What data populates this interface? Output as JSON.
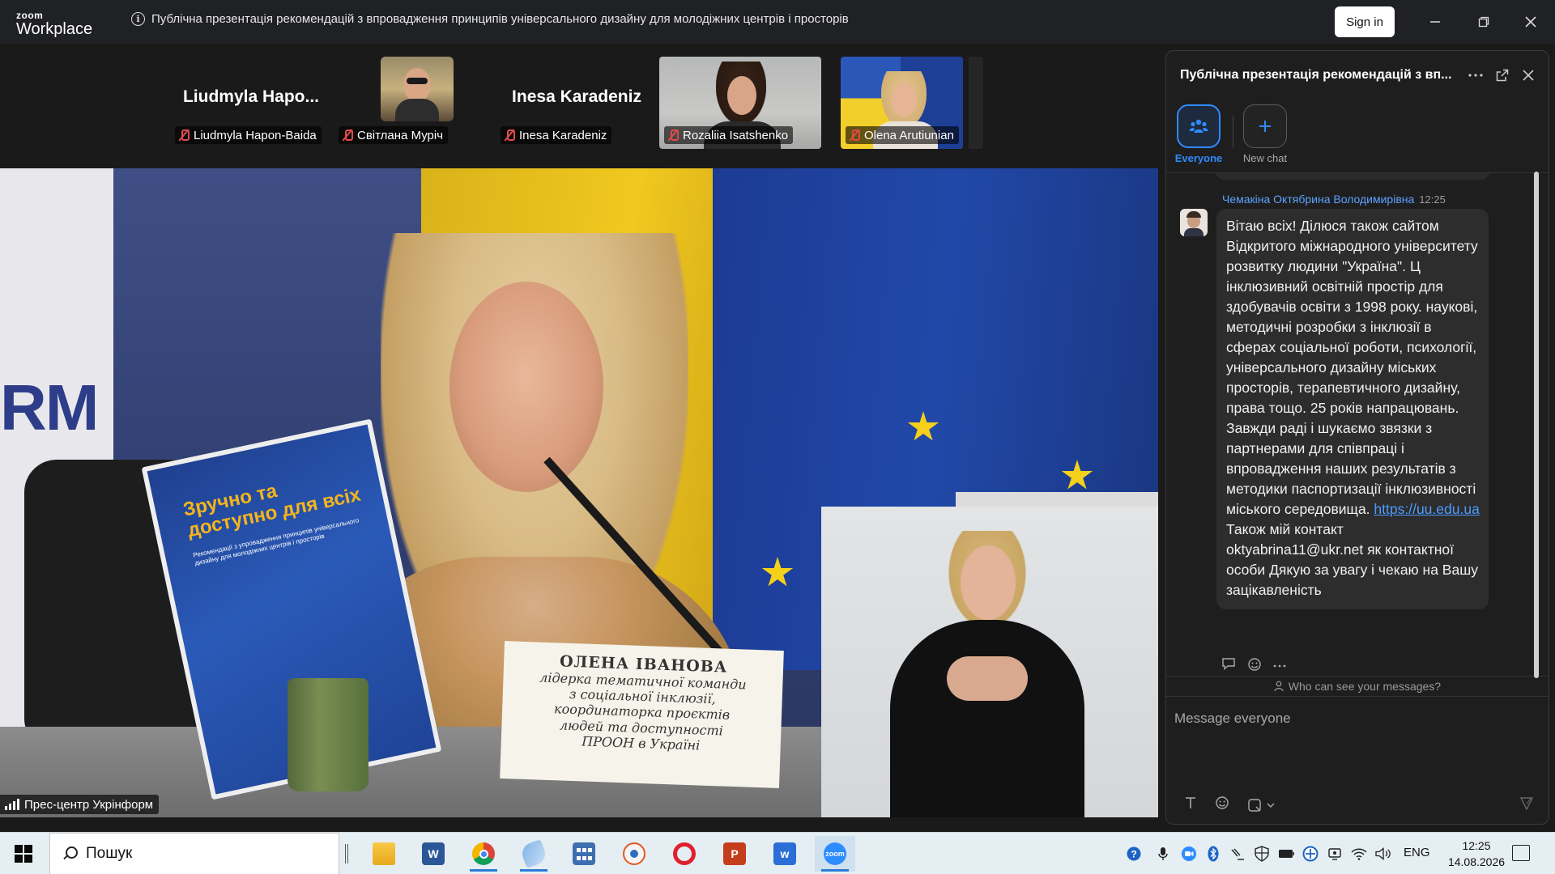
{
  "app": {
    "logo_top": "zoom",
    "logo_bottom": "Workplace",
    "meeting_title": "Публічна презентація рекомендацій з впровадження принципів універсального дизайну для молодіжних центрів і просторів",
    "info_icon": "i",
    "sign_in": "Sign in"
  },
  "participants": [
    {
      "big_name": "Liudmyla  Hapo...",
      "label": "Liudmyla Hapon-Baida"
    },
    {
      "big_name": "",
      "label": "Світлана Муріч"
    },
    {
      "big_name": "Inesa Karadeniz",
      "label": "Inesa Karadeniz"
    },
    {
      "big_name": "",
      "label": "Rozaliia Isatshenko"
    },
    {
      "big_name": "",
      "label": "Olena Arutiunian"
    }
  ],
  "main_video": {
    "caption": "Прес-центр Укрінформ",
    "wall_text": "RM",
    "book_title": "Зручно та доступно для всіх",
    "book_subtitle": "Рекомендації з упровадження принципів універсального дизайну для молодіжних центрів і просторів",
    "nameplate_name": "ОЛЕНА ІВАНОВА",
    "nameplate_line1": "лідерка тематичної команди",
    "nameplate_line2": "з соціальної інклюзії,",
    "nameplate_line3": "координаторка проєктів",
    "nameplate_line4": "людей та доступності",
    "nameplate_line5": "ПРООН в Україні"
  },
  "chat": {
    "title": "Публічна презентація рекомендацій з вп...",
    "tabs": [
      {
        "label": "Everyone",
        "icon": "people-icon",
        "active": true
      },
      {
        "label": "New chat",
        "icon": "plus-icon",
        "active": false
      }
    ],
    "message": {
      "sender": "Чемакіна Октябрина Володимирівна",
      "time": "12:25",
      "text": "Вітаю всіх! Ділюся також сайтом Відкритого міжнародного університету розвитку людини \"Україна\".  Ц інклюзивний освітній простір для здобувачів освіти з 1998 року. наукові, методичні розробки з інклюзії в сферах соціальної роботи, психології, універсального дизайну міських просторів, терапевтичного дизайну, права тощо. 25 років напрацювань. Завжди раді і шукаємо звязки з партнерами для співпраці і впровадження наших результатів з методики паспортизації інклюзивності міського середовища.",
      "link": "https://uu.edu.ua",
      "text_after": " Також мій контакт oktyabrina11@ukr.net як контактної особи    Дякую за увагу і чекаю на Вашу зацікавленість"
    },
    "who_can_see": "Who can see your messages?",
    "input_placeholder": "Message everyone"
  },
  "taskbar": {
    "search_placeholder": "Пошук",
    "apps": [
      "file-explorer",
      "word",
      "chrome",
      "paint",
      "calculator",
      "photos",
      "opera",
      "powerpoint",
      "word-2",
      "zoom"
    ],
    "language": "ENG",
    "time": "12:25",
    "date": "14.08.2026"
  },
  "colors": {
    "accent_blue": "#2d8cff",
    "link_blue": "#4d9bff",
    "sender_blue": "#5aa3ff",
    "mic_off_red": "#e04a4a"
  }
}
